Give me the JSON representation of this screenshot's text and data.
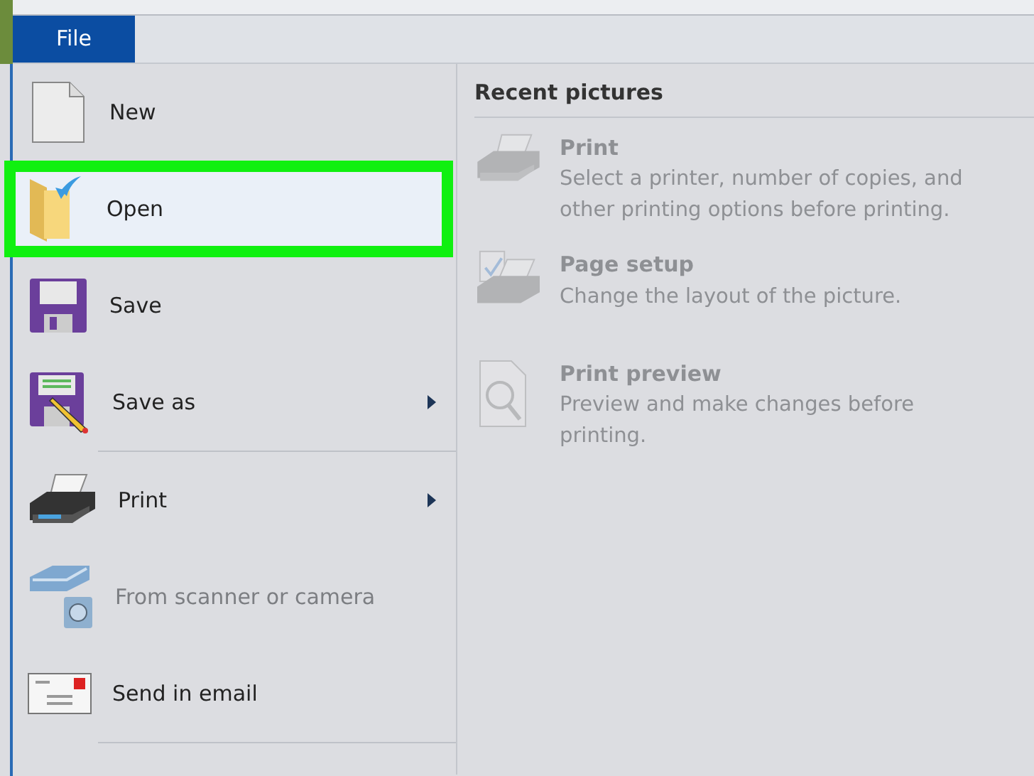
{
  "tab": {
    "label": "File",
    "selected": true
  },
  "menu_items": [
    {
      "label": "New",
      "selected": false,
      "disabled": false,
      "has_submenu": false,
      "divider_after": false
    },
    {
      "label": "Open",
      "selected": true,
      "disabled": false,
      "has_submenu": false,
      "divider_after": false
    },
    {
      "label": "Save",
      "selected": false,
      "disabled": false,
      "has_submenu": false,
      "divider_after": false
    },
    {
      "label": "Save as",
      "selected": false,
      "disabled": false,
      "has_submenu": true,
      "divider_after": true
    },
    {
      "label": "Print",
      "selected": false,
      "disabled": false,
      "has_submenu": true,
      "divider_after": false
    },
    {
      "label": "From scanner or camera",
      "selected": false,
      "disabled": true,
      "has_submenu": false,
      "divider_after": false
    },
    {
      "label": "Send in email",
      "selected": false,
      "disabled": false,
      "has_submenu": false,
      "divider_after": true
    }
  ],
  "recent_panel": {
    "title": "Recent pictures",
    "items": [
      {
        "title": "Print",
        "description": "Select a printer, number of copies, and other printing options before printing.",
        "disabled": true
      },
      {
        "title": "Page setup",
        "description": "Change the layout of the picture.",
        "disabled": true
      },
      {
        "title": "Print preview",
        "description": "Preview and make changes before printing.",
        "disabled": true
      }
    ]
  }
}
